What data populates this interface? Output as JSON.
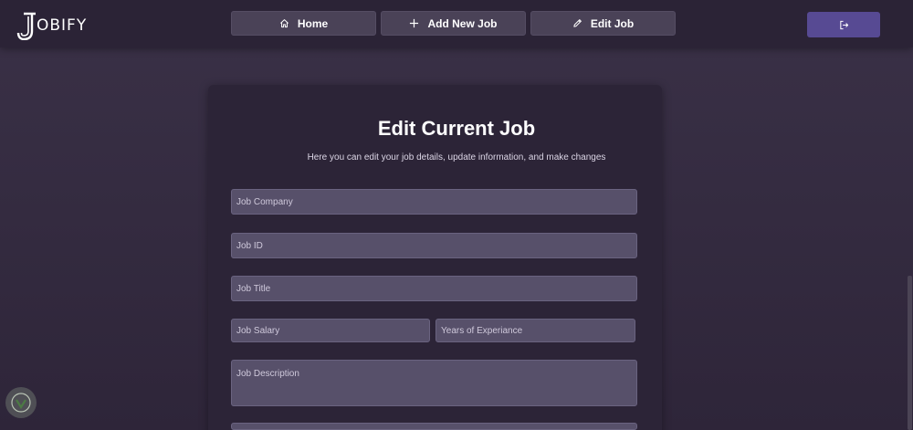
{
  "brand": {
    "logo_letter": "J",
    "logo_rest": "OBIFY"
  },
  "nav": {
    "home_label": "Home",
    "add_label": "Add New Job",
    "edit_label": "Edit Job"
  },
  "form": {
    "title": "Edit Current Job",
    "subtitle": "Here you can edit your job details, update information, and make changes",
    "company_placeholder": "Job Company",
    "id_placeholder": "Job ID",
    "title_placeholder": "Job Title",
    "salary_placeholder": "Job Salary",
    "experience_placeholder": "Years of Experiance",
    "description_placeholder": "Job Description"
  },
  "colors": {
    "background": "#3a3147",
    "navbar": "#2b2336",
    "card": "#2c2437",
    "input": "#57506a",
    "accent": "#574a93"
  },
  "icons": [
    "home-icon",
    "plus-icon",
    "pencil-icon",
    "logout-icon"
  ]
}
